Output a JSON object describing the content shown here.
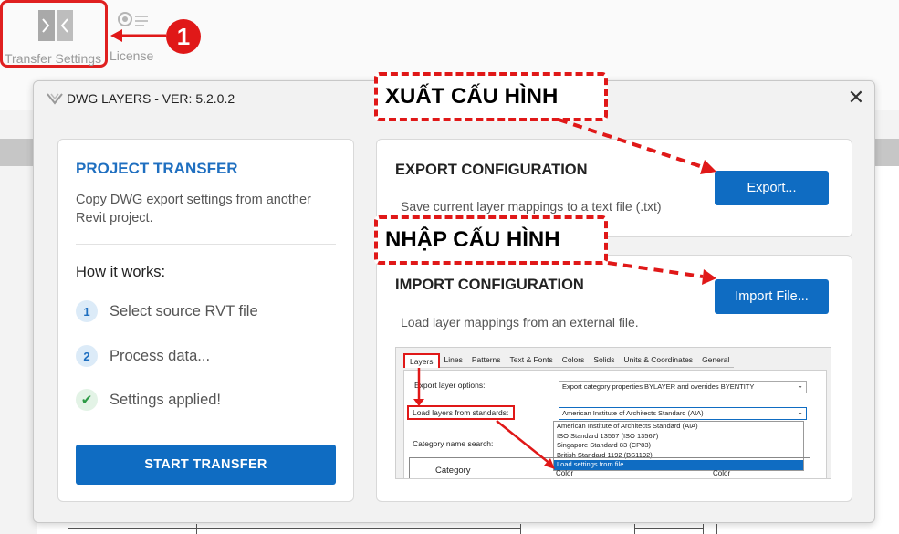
{
  "ribbon": {
    "transfer_label": "Transfer Settings",
    "license_label": "License",
    "callout_number": "1"
  },
  "dialog": {
    "title": "DWG LAYERS - VER: 5.2.0.2",
    "close_glyph": "✕",
    "project_transfer": {
      "title": "PROJECT TRANSFER",
      "description": "Copy DWG export settings from another Revit project.",
      "how_it_works": "How it works:",
      "steps": [
        {
          "badge": "1",
          "text": "Select source RVT file"
        },
        {
          "badge": "2",
          "text": "Process data..."
        },
        {
          "badge": "✔",
          "text": "Settings applied!"
        }
      ],
      "start_button": "START TRANSFER"
    },
    "export": {
      "title": "EXPORT CONFIGURATION",
      "description": "Save current layer mappings to a text file (.txt)",
      "button": "Export..."
    },
    "import": {
      "title": "IMPORT CONFIGURATION",
      "description": "Load layer mappings from an external file.",
      "button": "Import File..."
    },
    "screenshot": {
      "tabs": [
        "Layers",
        "Lines",
        "Patterns",
        "Text & Fonts",
        "Colors",
        "Solids",
        "Units & Coordinates",
        "General"
      ],
      "export_layer_options_label": "Export layer options:",
      "export_layer_options_value": "Export category properties BYLAYER and overrides BYENTITY",
      "load_layers_label": "Load layers from standards:",
      "load_layers_value": "American Institute of Architects Standard (AIA)",
      "dropdown_options": [
        "American Institute of Architects Standard (AIA)",
        "ISO Standard 13567 (ISO 13567)",
        "Singapore Standard 83 (CP83)",
        "British Standard 1192 (BS1192)",
        "Load settings from file..."
      ],
      "category_search_label": "Category name search:",
      "table_header_category": "Category",
      "table_header_color": "Color",
      "table_header_color2": "Color"
    }
  },
  "annotations": {
    "export_vn": "XUẤT CẤU HÌNH",
    "import_vn": "NHẬP CẤU HÌNH"
  },
  "colors": {
    "accent_blue": "#0f6cc2",
    "title_blue": "#1f6fc0",
    "annotation_red": "#e01818"
  }
}
